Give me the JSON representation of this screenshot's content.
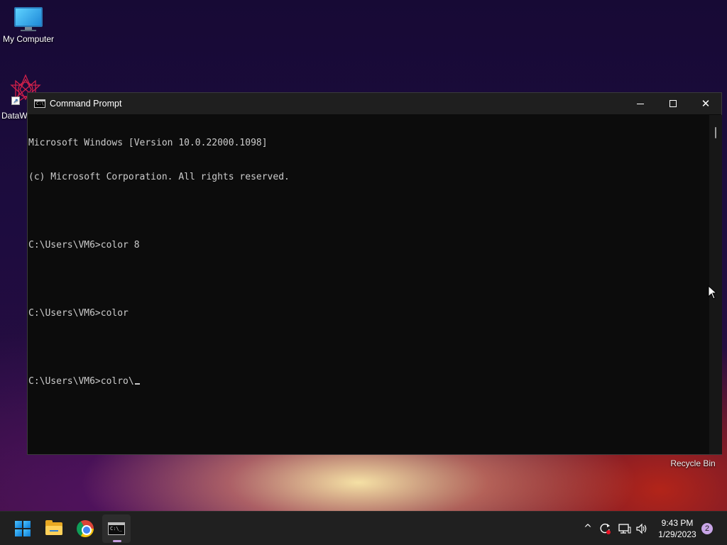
{
  "desktop": {
    "icons": [
      {
        "label": "My Computer"
      },
      {
        "label": "DataW"
      },
      {
        "label": "Recycle Bin"
      }
    ]
  },
  "window": {
    "title": "Command Prompt",
    "icon": "cmd-icon",
    "controls": {
      "minimize": "minimize-icon",
      "maximize": "maximize-icon",
      "close": "close-icon"
    },
    "console": {
      "lines": [
        "Microsoft Windows [Version 10.0.22000.1098]",
        "(c) Microsoft Corporation. All rights reserved.",
        "",
        "C:\\Users\\VM6>color 8",
        "",
        "C:\\Users\\VM6>color",
        "",
        "C:\\Users\\VM6>colro\\"
      ],
      "text_color": "#cccccc",
      "background": "#0c0c0c"
    }
  },
  "taskbar": {
    "apps": [
      {
        "name": "start",
        "icon": "windows-logo-icon"
      },
      {
        "name": "file-explorer",
        "icon": "folder-icon"
      },
      {
        "name": "chrome",
        "icon": "chrome-icon"
      },
      {
        "name": "command-prompt",
        "icon": "cmd-icon",
        "active": true
      }
    ],
    "tray": {
      "chevron": "^",
      "time": "9:43 PM",
      "date": "1/29/2023",
      "notifications": "2"
    },
    "accent": "#c9a6e8"
  }
}
